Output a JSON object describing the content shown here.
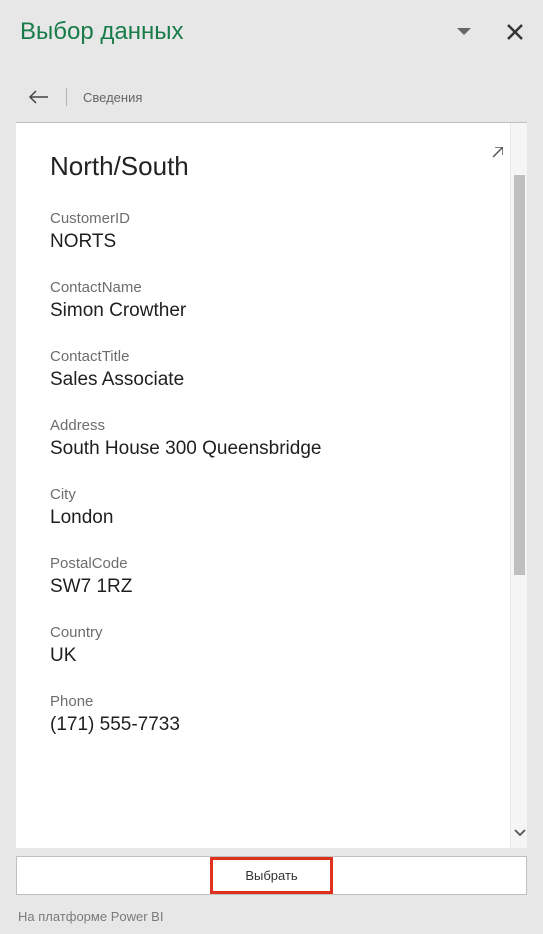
{
  "header": {
    "title": "Выбор данных"
  },
  "breadcrumb": {
    "text": "Сведения"
  },
  "entity": {
    "title": "North/South"
  },
  "fields": {
    "customerId": {
      "label": "CustomerID",
      "value": "NORTS"
    },
    "contactName": {
      "label": "ContactName",
      "value": "Simon Crowther"
    },
    "contactTitle": {
      "label": "ContactTitle",
      "value": "Sales Associate"
    },
    "address": {
      "label": "Address",
      "value": "South House 300 Queensbridge"
    },
    "city": {
      "label": "City",
      "value": "London"
    },
    "postalCode": {
      "label": "PostalCode",
      "value": "SW7 1RZ"
    },
    "country": {
      "label": "Country",
      "value": "UK"
    },
    "phone": {
      "label": "Phone",
      "value": "(171) 555-7733"
    }
  },
  "actions": {
    "select": "Выбрать"
  },
  "footer": {
    "text": "На платформе Power BI"
  }
}
